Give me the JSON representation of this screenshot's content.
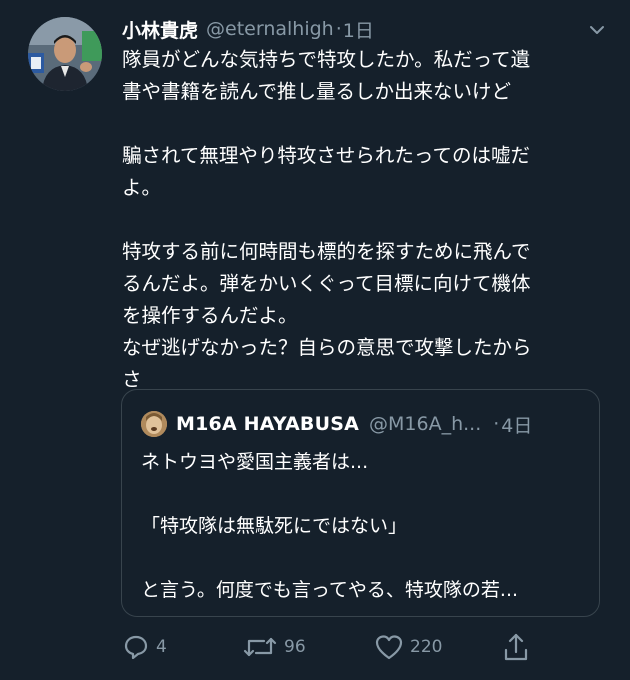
{
  "tweet": {
    "display_name": "小林貴虎",
    "handle": "@eternalhigh",
    "separator": "·",
    "time": "1日",
    "body_lines": [
      "隊員がどんな気持ちで特攻したか。私だって遺",
      "書や書籍を読んで推し量るしか出来ないけど",
      "",
      "騙されて無理やり特攻させられたってのは嘘だ",
      "よ。",
      "",
      "特攻する前に何時間も標的を探すために飛んで",
      "るんだよ。弾をかいくぐって目標に向けて機体",
      "を操作するんだよ。",
      "なぜ逃げなかった？自らの意思で攻撃したから",
      "さ"
    ]
  },
  "quote": {
    "display_name": "M16A  HAYABUSA",
    "handle": "@M16A_h...",
    "separator": "·",
    "time": "4日",
    "lines": [
      "ネトウヨや愛国主義者は...",
      "",
      "「特攻隊は無駄死にではない」",
      "",
      "と言う。何度でも言ってやる、特攻隊の若..."
    ]
  },
  "actions": {
    "reply_count": "4",
    "retweet_count": "96",
    "like_count": "220"
  },
  "icons": {
    "reply": "reply-icon",
    "retweet": "retweet-icon",
    "like": "heart-icon",
    "share": "share-icon",
    "more": "chevron-down-icon"
  },
  "colors": {
    "background": "#15202b",
    "secondary_text": "#8899a6",
    "border": "#38444d"
  }
}
